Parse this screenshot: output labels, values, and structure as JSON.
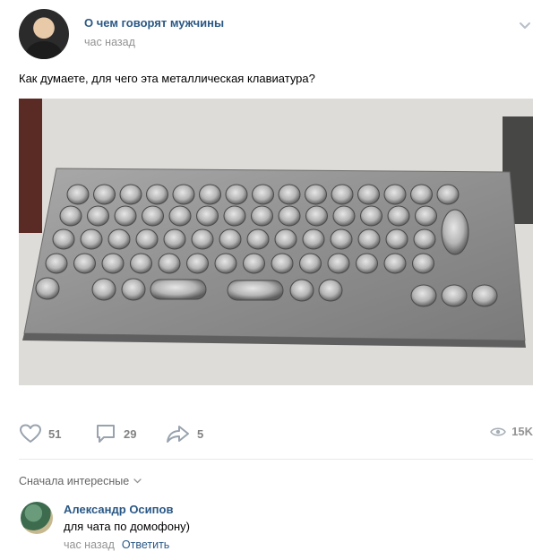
{
  "post": {
    "group_name": "О чем говорят мужчины",
    "time": "час назад",
    "text": "Как думаете, для чего эта металлическая клавиатура?"
  },
  "actions": {
    "likes": "51",
    "comments": "29",
    "shares": "5",
    "views": "15K"
  },
  "comments_section": {
    "sort_label": "Сначала интересные",
    "items": [
      {
        "author": "Александр Осипов",
        "text": "для чата по домофону)",
        "time": "час назад",
        "reply_label": "Ответить"
      }
    ]
  },
  "colors": {
    "link": "#2a5885",
    "muted": "#939393",
    "icon": "#99a2ad"
  }
}
